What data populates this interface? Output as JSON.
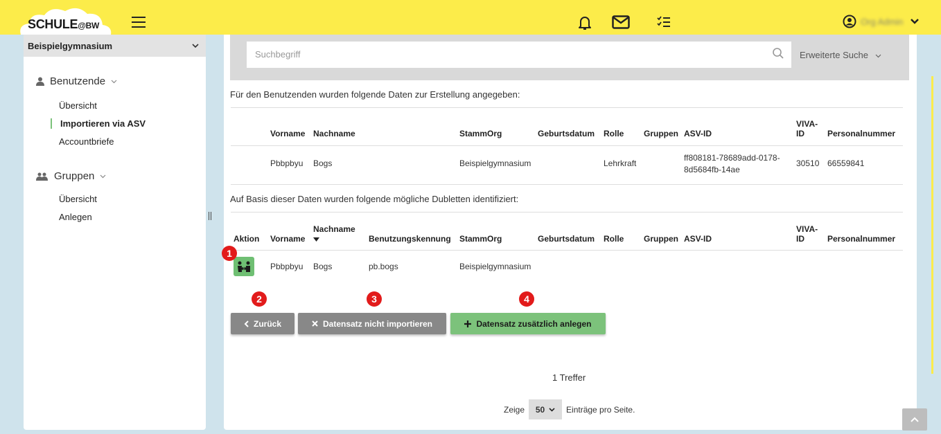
{
  "header": {
    "logo": "SCHULE",
    "logo_suffix": "@BW",
    "user_name": "Org Admin",
    "icons": [
      "bell-icon",
      "mail-icon",
      "tasks-icon",
      "user-circle-icon",
      "chevron-down-icon"
    ]
  },
  "sidebar": {
    "org": "Beispielgymnasium",
    "groups": [
      {
        "label": "Benutzende",
        "items": [
          "Übersicht",
          "Importieren via ASV",
          "Accountbriefe"
        ]
      },
      {
        "label": "Gruppen",
        "items": [
          "Übersicht",
          "Anlegen"
        ]
      }
    ]
  },
  "search": {
    "placeholder": "Suchbegriff",
    "extended": "Erweiterte Suche"
  },
  "section1": {
    "caption": "Für den Benutzenden wurden folgende Daten zur Erstellung angegeben:",
    "headers": [
      "Vorname",
      "Nachname",
      "StammOrg",
      "Geburtsdatum",
      "Rolle",
      "Gruppen",
      "ASV-ID",
      "VIVA-ID",
      "Personalnummer"
    ],
    "row": {
      "vorname": "Pbbpbyu",
      "nachname": "Bogs",
      "stammorg": "Beispielgymnasium",
      "geburtsdatum": "",
      "rolle": "Lehrkraft",
      "gruppen": "",
      "asv_id_1": "ff808181-78689add-0178-",
      "asv_id_2": "8d5684fb-14ae",
      "viva_id": "30510",
      "personalnummer": "66559841"
    }
  },
  "section2": {
    "caption": "Auf Basis dieser Daten wurden folgende mögliche Dubletten identifiziert:",
    "headers": [
      "Aktion",
      "Vorname",
      "Nachname",
      "Benutzungskennung",
      "StammOrg",
      "Geburtsdatum",
      "Rolle",
      "Gruppen",
      "ASV-ID",
      "VIVA-ID",
      "Personalnummer"
    ],
    "row": {
      "vorname": "Pbbpbyu",
      "nachname": "Bogs",
      "kennung": "pb.bogs",
      "stammorg": "Beispielgymnasium"
    }
  },
  "markers": [
    "1",
    "2",
    "3",
    "4"
  ],
  "buttons": {
    "back": "Zurück",
    "skip": "Datensatz nicht importieren",
    "add": "Datensatz zusätzlich anlegen"
  },
  "footer": {
    "hits": "1 Treffer",
    "show": "Zeige",
    "page_size": "50",
    "per_page": "Einträge pro Seite."
  },
  "colors": {
    "topbar": "#fcec4a",
    "green": "#7cc27b",
    "grey_button": "#888888",
    "marker": "#e21b1b"
  }
}
